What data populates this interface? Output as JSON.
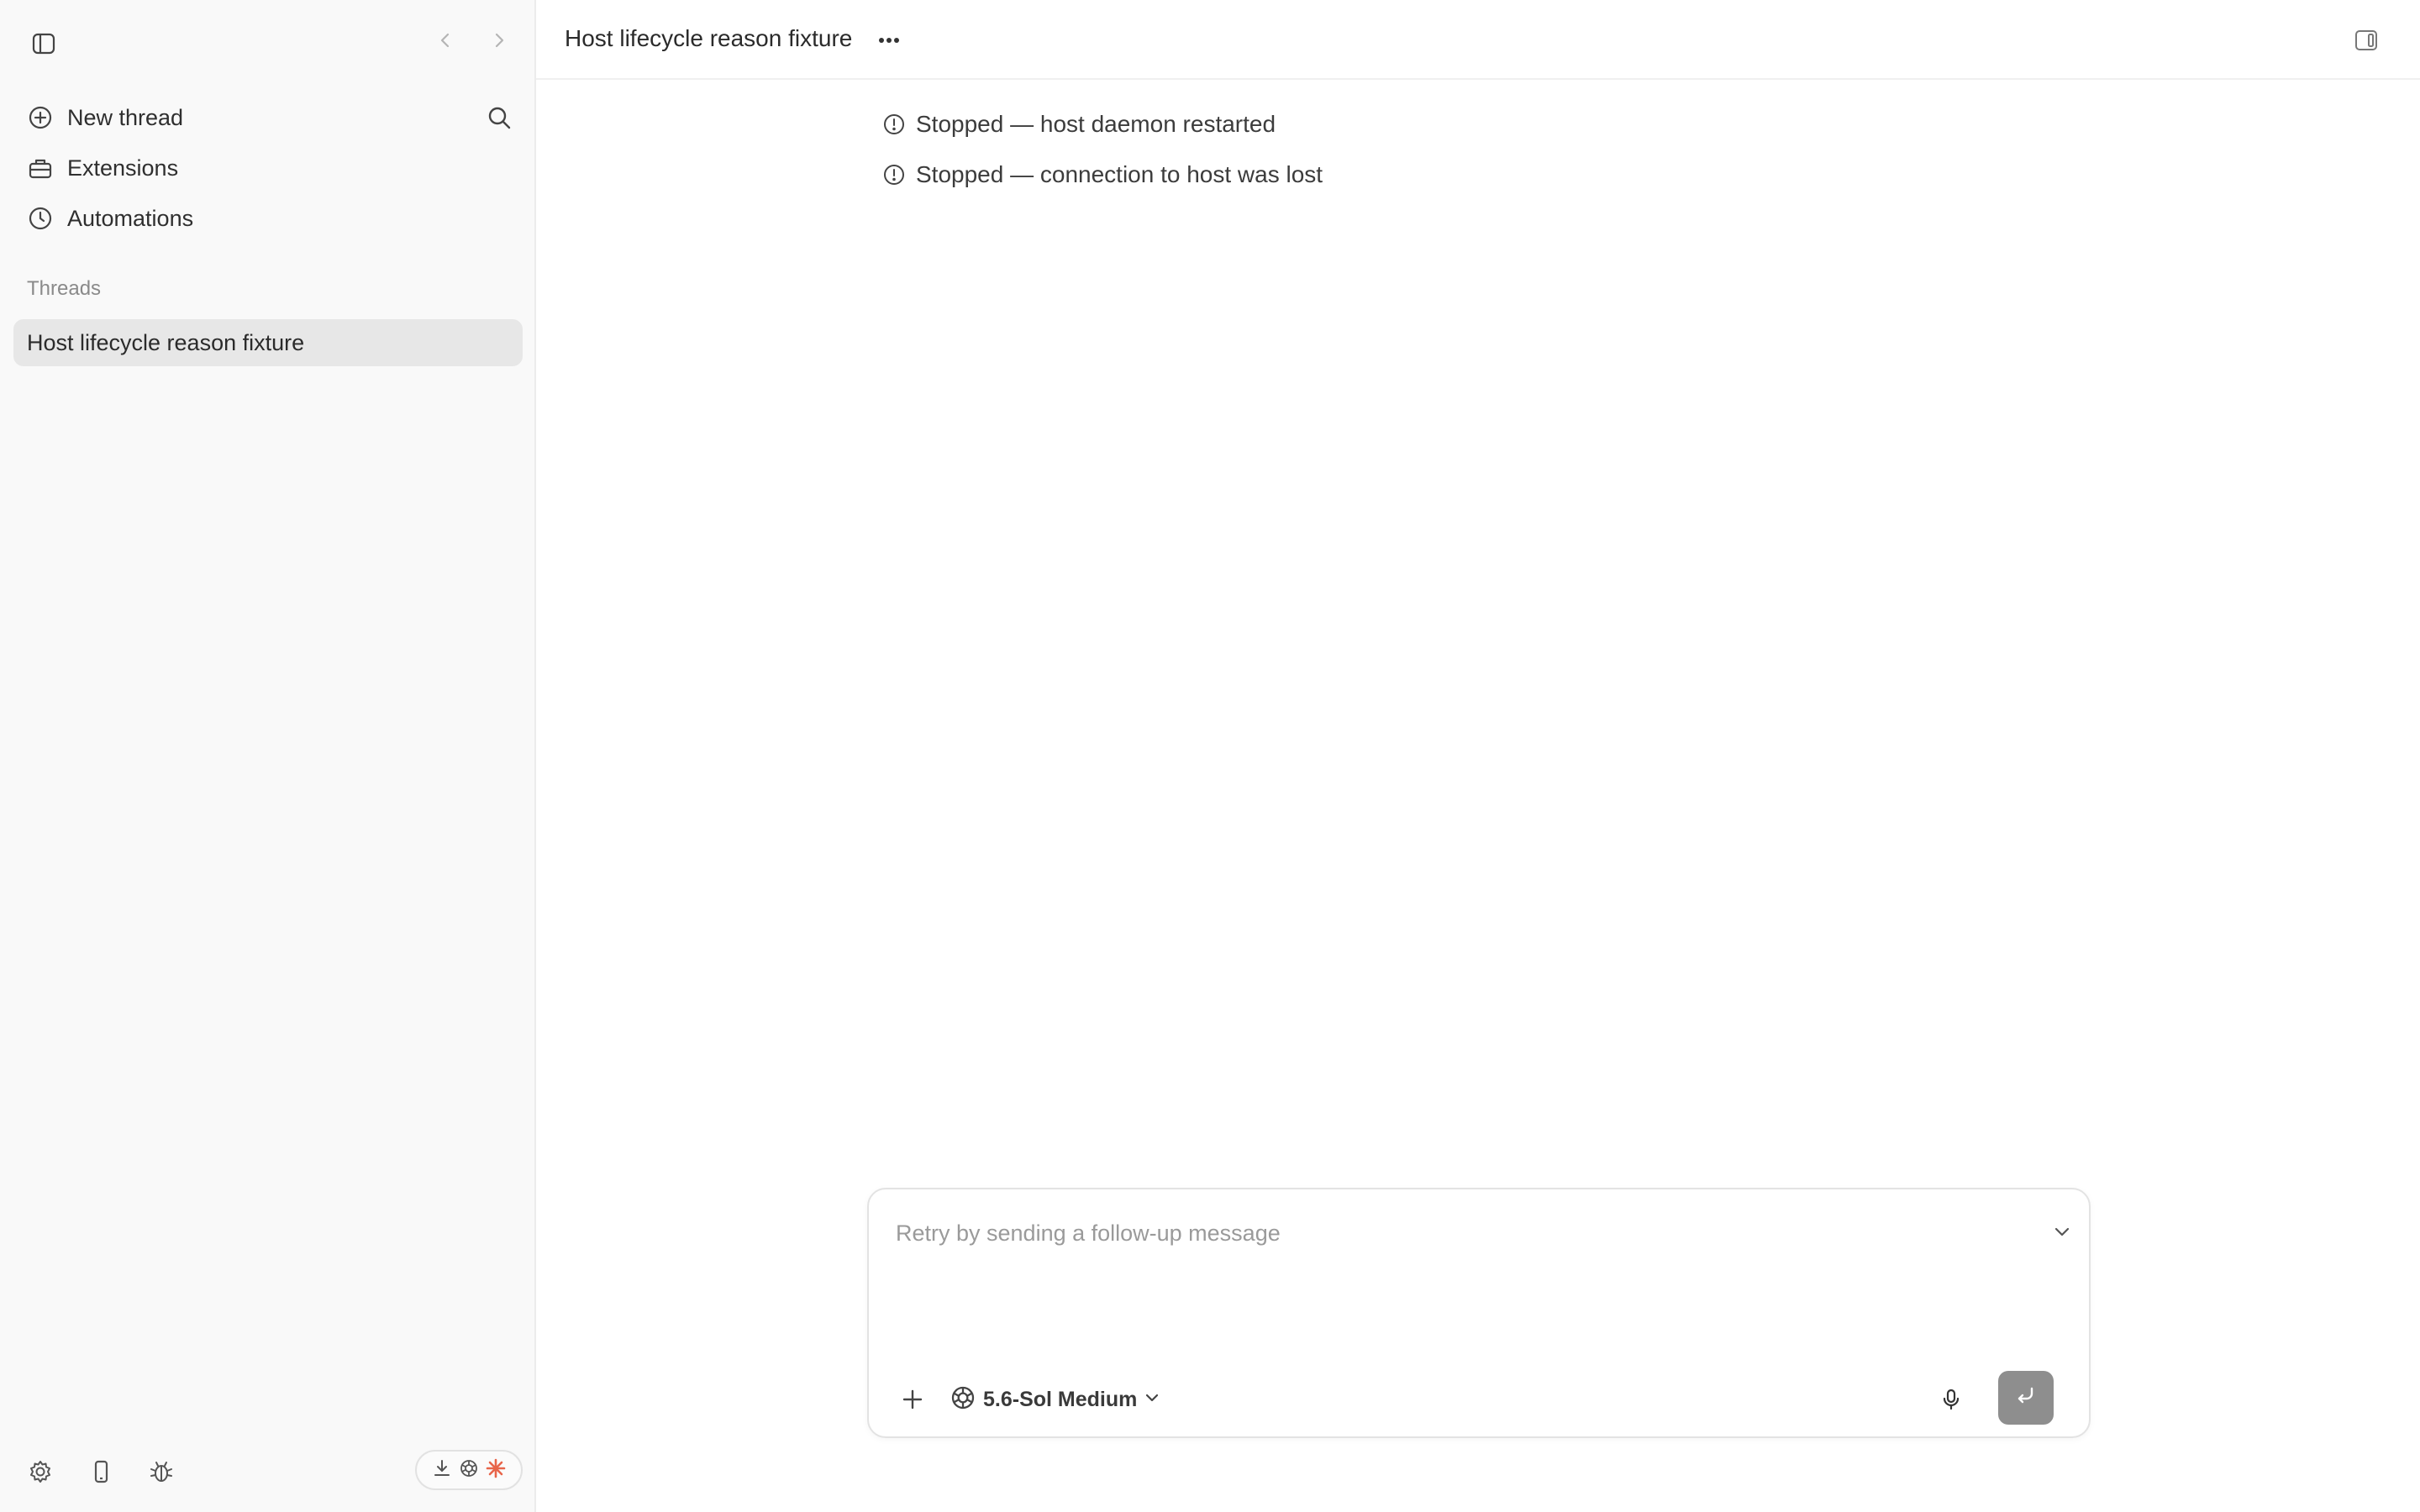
{
  "sidebar": {
    "toggle_icon": "sidebar-toggle-icon",
    "back_icon": "chevron-left-icon",
    "forward_icon": "chevron-right-icon",
    "nav": [
      {
        "label": "New thread",
        "icon": "plus-circle-icon"
      },
      {
        "label": "Extensions",
        "icon": "toolbox-icon"
      },
      {
        "label": "Automations",
        "icon": "clock-icon"
      }
    ],
    "search_icon": "search-icon",
    "threads_heading": "Threads",
    "threads": [
      {
        "label": "Host lifecycle reason fixture",
        "selected": true
      }
    ],
    "footer_icons": [
      "gear-icon",
      "phone-icon",
      "bug-icon"
    ],
    "status_pill_icons": [
      "download-icon",
      "openai-icon",
      "spark-icon"
    ]
  },
  "header": {
    "title": "Host lifecycle reason fixture",
    "more_icon": "ellipsis-icon",
    "panel_toggle_icon": "right-panel-toggle-icon"
  },
  "messages": [
    {
      "icon": "alert-circle-icon",
      "text": "Stopped — host daemon restarted"
    },
    {
      "icon": "alert-circle-icon",
      "text": "Stopped — connection to host was lost"
    }
  ],
  "composer": {
    "placeholder": "Retry by sending a follow-up message",
    "value": "",
    "model_label": "5.6-Sol Medium",
    "model_icon": "openai-icon",
    "attach_icon": "plus-icon",
    "expand_icon": "chevron-down-icon",
    "mic_icon": "microphone-icon",
    "send_icon": "return-arrow-icon"
  },
  "colors": {
    "sidebar_bg": "#f9f9f9",
    "selected_thread_bg": "#e7e7e7",
    "send_button_bg": "#8e8e8e",
    "spark_accent": "#e8654a"
  }
}
